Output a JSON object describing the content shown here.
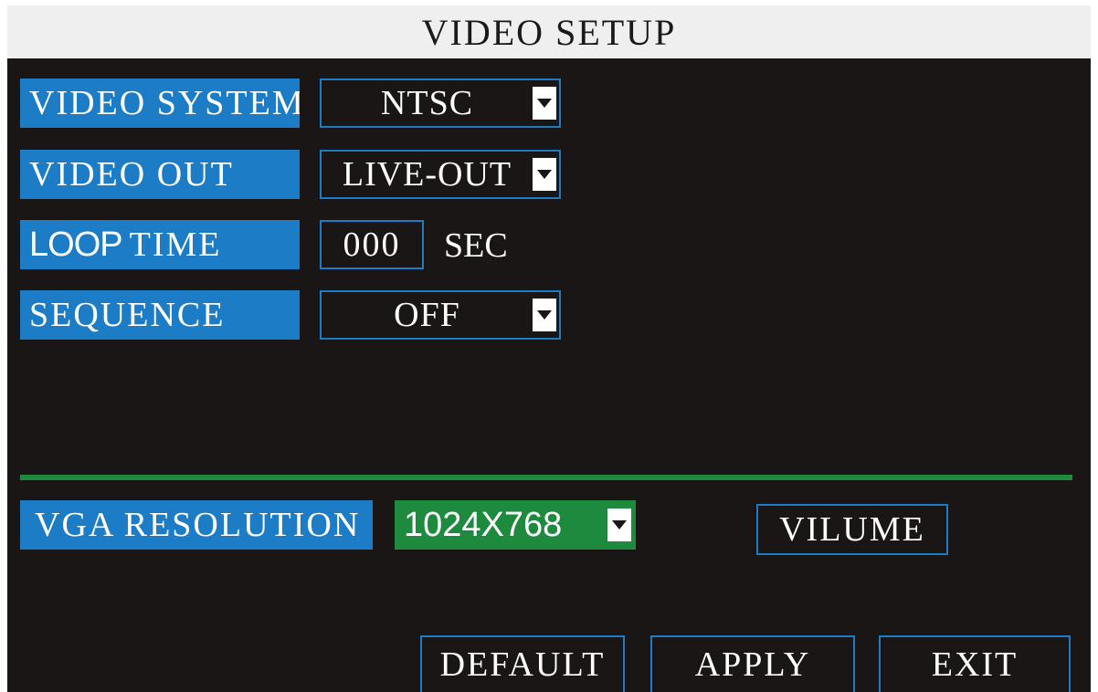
{
  "header": {
    "title": "VIDEO SETUP"
  },
  "settings": {
    "video_system": {
      "label": "VIDEO SYSTEM",
      "value": "NTSC"
    },
    "video_out": {
      "label": "VIDEO OUT",
      "value": "LIVE-OUT"
    },
    "loop_time": {
      "label_a": "LOOP",
      "label_b": "TIME",
      "value": "000",
      "unit": "SEC"
    },
    "sequence": {
      "label": "SEQUENCE",
      "value": "OFF"
    },
    "vga_resolution": {
      "label": "VGA RESOLUTION",
      "value": "1024X768"
    }
  },
  "buttons": {
    "volume": "VILUME",
    "default": "DEFAULT",
    "apply": "APPLY",
    "exit": "EXIT"
  },
  "colors": {
    "label_bg": "#1d7cc6",
    "panel_bg": "#1a1616",
    "divider": "#1d8a3e",
    "selected_bg": "#1d8a3e"
  },
  "icons": {
    "dropdown": "chevron-down-icon"
  }
}
